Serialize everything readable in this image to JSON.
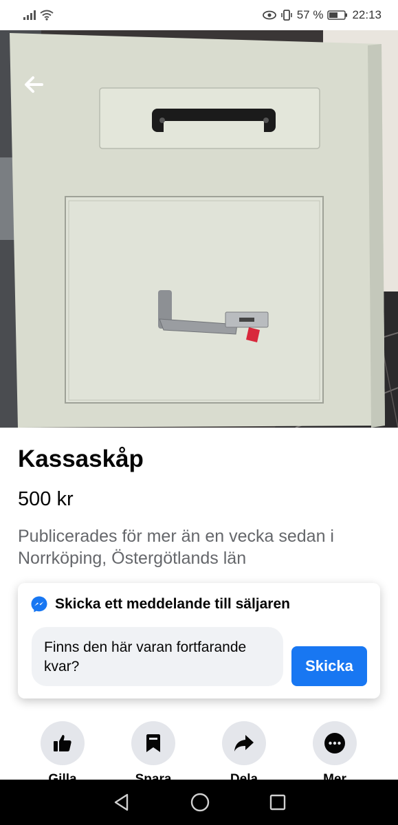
{
  "status_bar": {
    "battery": "57 %",
    "time": "22:13"
  },
  "listing": {
    "title": "Kassaskåp",
    "price": "500 kr",
    "meta": "Publicerades för mer än en vecka sedan i Norrköping, Östergötlands län"
  },
  "message": {
    "header": "Skicka ett meddelande till säljaren",
    "input_value": "Finns den här varan fortfarande kvar?",
    "send_label": "Skicka"
  },
  "actions": [
    {
      "label": "Gilla",
      "icon": "thumbs-up-icon"
    },
    {
      "label": "Spara",
      "icon": "bookmark-icon"
    },
    {
      "label": "Dela",
      "icon": "share-icon"
    },
    {
      "label": "Mer",
      "icon": "more-icon"
    }
  ],
  "colors": {
    "accent": "#1877f2",
    "secondary_text": "#65676b",
    "action_bg": "#e4e6eb"
  }
}
